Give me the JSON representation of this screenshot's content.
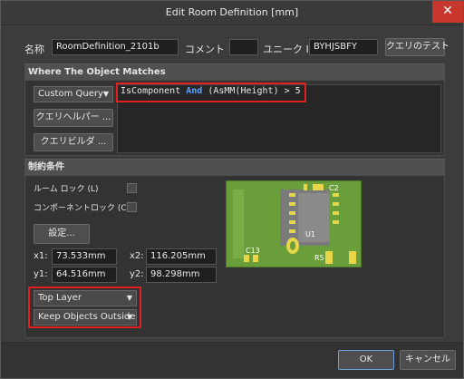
{
  "window": {
    "title": "Edit Room Definition [mm]",
    "close_glyph": "✕"
  },
  "header": {
    "name_label": "名称",
    "name_value": "RoomDefinition_2101b",
    "comment_label": "コメント",
    "comment_value": "",
    "uid_label": "ユニーク ID",
    "uid_value": "BYHJSBFY",
    "test_query_button": "クエリのテスト"
  },
  "where_section": {
    "heading": "Where The Object Matches",
    "query_type": "Custom Query",
    "query_parts": {
      "p1": "IsComponent ",
      "kw": "And",
      "p2": " (AsMM(Height) > 5"
    },
    "query_helper_button": "クエリヘルパー ...",
    "query_builder_button": "クエリビルダ ..."
  },
  "constraints": {
    "heading": "制約条件",
    "room_lock_label": "ルーム ロック (L)",
    "component_lock_label": "コンポーネントロック (C)",
    "settings_button": "設定...",
    "x1_label": "x1:",
    "x1_value": "73.533mm",
    "y1_label": "y1:",
    "y1_value": "64.516mm",
    "x2_label": "x2:",
    "x2_value": "116.205mm",
    "y2_label": "y2:",
    "y2_value": "98.298mm",
    "layer_value": "Top Layer",
    "keep_value": "Keep Objects Outside",
    "preview_labels": {
      "c2": "C2",
      "u1": "U1",
      "c13": "C13",
      "r5": "R5"
    }
  },
  "footer": {
    "ok_button": "OK",
    "cancel_button": "キャンセル"
  },
  "colors": {
    "accent_red": "#e02020",
    "keyword_blue": "#5aa0ff",
    "close_red": "#c8372d",
    "pcb_green": "#6a9e3a"
  }
}
